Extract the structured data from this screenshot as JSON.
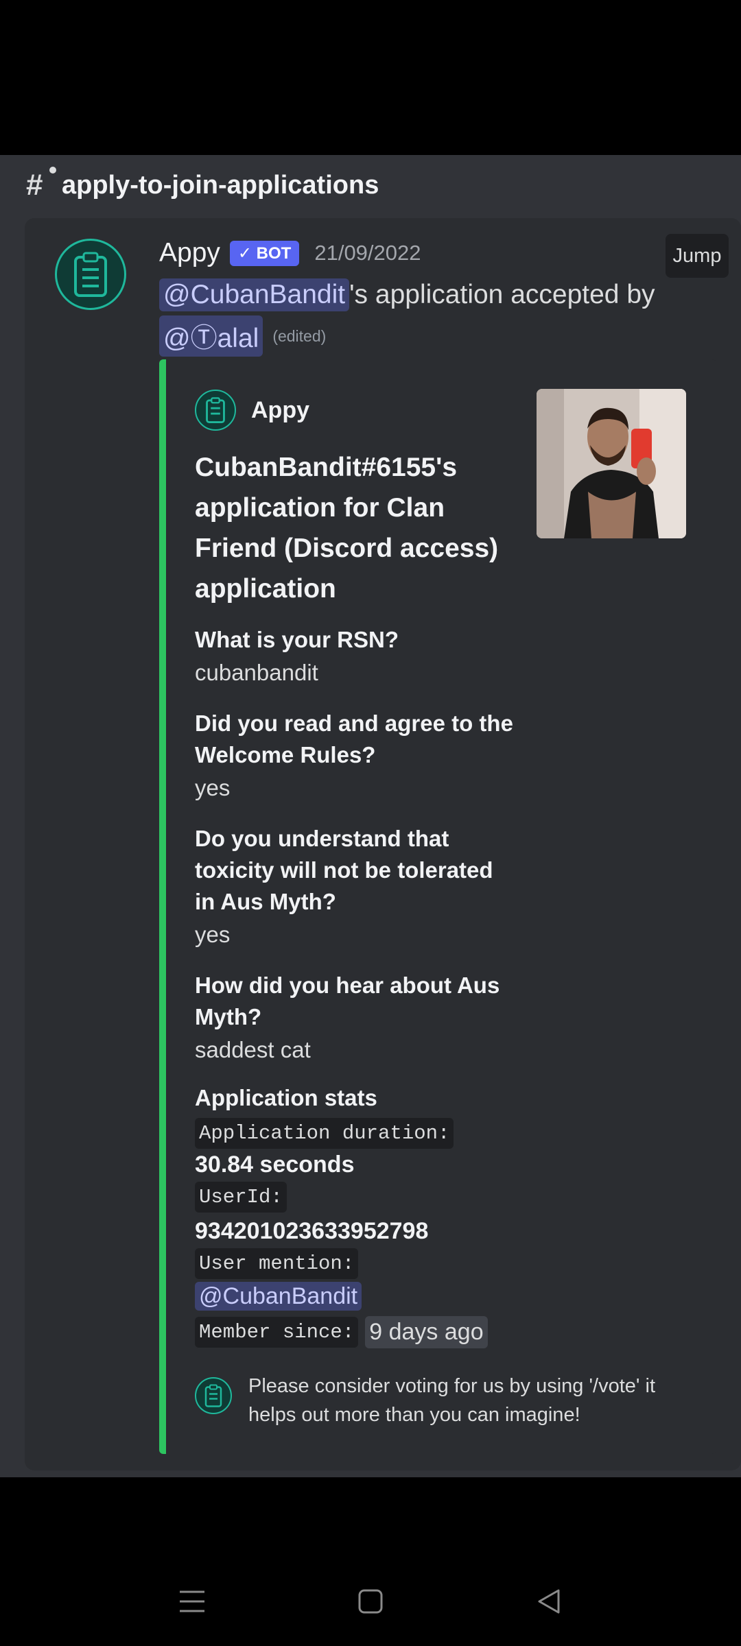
{
  "channel": {
    "name": "apply-to-join-applications",
    "icon": "hash-thread-icon"
  },
  "message": {
    "author": "Appy",
    "bot_badge": "✓ BOT",
    "timestamp": "21/09/2022",
    "jump_label": "Jump",
    "mention_applicant": "@CubanBandit",
    "accepted_text": "'s application accepted by",
    "mention_accepter": "@Ⓣalal",
    "edited_label": "(edited)",
    "avatar_icon": "clipboard-checklist-icon"
  },
  "embed": {
    "accent_color": "#2dc460",
    "author_name": "Appy",
    "title": "CubanBandit#6155's application for Clan Friend (Discord access) application",
    "thumbnail": "user-selfie-photo",
    "fields": [
      {
        "name": "What is your RSN?",
        "value": "cubanbandit"
      },
      {
        "name": "Did you read and agree to the Welcome Rules?",
        "value": "yes"
      },
      {
        "name": "Do you understand that toxicity will not be tolerated in Aus Myth?",
        "value": "yes"
      },
      {
        "name": "How did you hear about Aus Myth?",
        "value": "saddest cat"
      }
    ],
    "stats": {
      "heading": "Application stats",
      "duration_label": "Application duration:",
      "duration_value": "30.84 seconds",
      "userid_label": "UserId:",
      "userid_value": "934201023633952798",
      "mention_label": "User mention:",
      "mention_value": "@CubanBandit",
      "member_label": "Member since:",
      "member_value": "9 days ago"
    },
    "footer": "Please consider voting for us by using '/vote' it helps out more than you can imagine!"
  },
  "navbar": {
    "recent": "menu-lines-icon",
    "home": "square-home-icon",
    "back": "triangle-back-icon"
  }
}
